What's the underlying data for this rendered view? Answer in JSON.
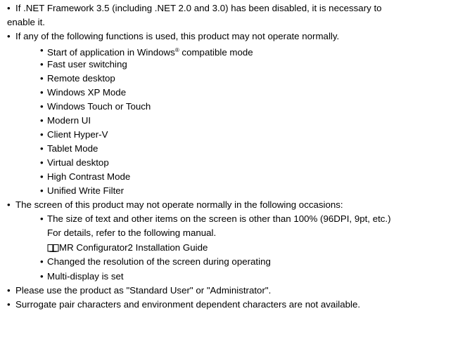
{
  "bullet_glyph": "•",
  "items": [
    {
      "text": "If .NET Framework 3.5 (including .NET 2.0 and 3.0) has been disabled, it is necessary to",
      "continuation": "enable it."
    },
    {
      "text": "If any of the following functions is used, this product may not operate normally.",
      "subitems": [
        {
          "text": "Start of application in Windows",
          "mark": "®",
          "after": " compatible mode"
        },
        {
          "text": "Fast user switching"
        },
        {
          "text": "Remote desktop"
        },
        {
          "text": "Windows XP Mode"
        },
        {
          "text": "Windows Touch or Touch"
        },
        {
          "text": "Modern UI"
        },
        {
          "text": "Client Hyper-V"
        },
        {
          "text": "Tablet Mode"
        },
        {
          "text": "Virtual desktop"
        },
        {
          "text": "High Contrast Mode"
        },
        {
          "text": "Unified Write Filter"
        }
      ]
    },
    {
      "text": "The screen of this product may not operate normally in the following occasions:",
      "subitems": [
        {
          "text": "The size of text and other items on the screen is other than 100% (96DPI, 9pt, etc.)",
          "continuation": "For details, refer to the following manual.",
          "reference": "MR Configurator2 Installation Guide",
          "reference_icon": "manual-book-icon"
        },
        {
          "text": "Changed the resolution of the screen during operating"
        },
        {
          "text": "Multi-display is set"
        }
      ]
    },
    {
      "text": "Please use the product as \"Standard User\" or \"Administrator\"."
    },
    {
      "text": "Surrogate pair characters and environment dependent characters are not available."
    }
  ]
}
